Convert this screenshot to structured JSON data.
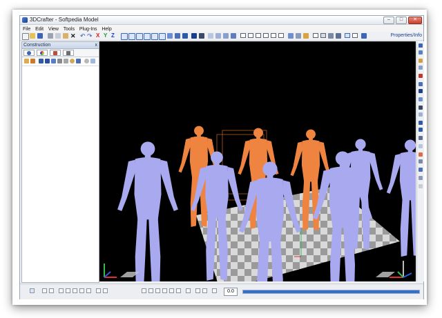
{
  "window": {
    "title": "3DCrafter - Softpedia Model",
    "min_label": "–",
    "max_label": "□",
    "close_label": "✕"
  },
  "menu": {
    "items": [
      "File",
      "Edit",
      "View",
      "Tools",
      "Plug-Ins",
      "Help"
    ]
  },
  "toolbar": {
    "axis_x": "X",
    "axis_y": "Y",
    "axis_z": "Z",
    "properties_label": "Properties/Info",
    "icons": [
      "new-icon",
      "open-icon",
      "save-icon",
      "cut-icon",
      "copy-icon",
      "paste-icon",
      "delete-icon",
      "undo-icon",
      "redo-icon"
    ]
  },
  "panel": {
    "title": "Construction",
    "close_label": "x",
    "tabs": [
      "primitives-tab-icon",
      "materials-tab-icon",
      "paint-tab-icon",
      "tools-tab-icon"
    ]
  },
  "status": {
    "frame_value": "0.0",
    "timeline_progress": 1.0
  },
  "colors": {
    "viewport_bg": "#000000",
    "figure_purple": "#a9a9ef",
    "figure_orange": "#ee8440",
    "floor_light": "#d9d9d9",
    "floor_dark": "#9a9a9a",
    "accent": "#2f6fd1"
  }
}
